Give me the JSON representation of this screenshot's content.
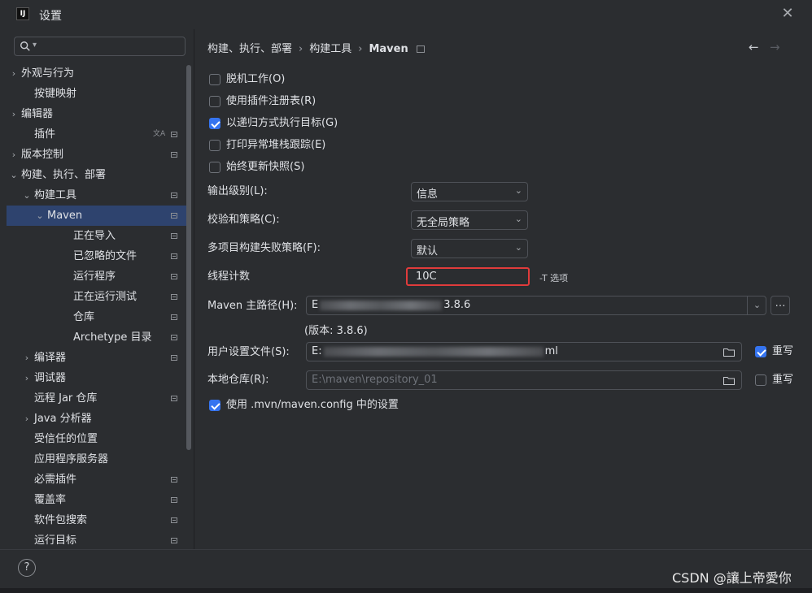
{
  "window": {
    "title": "设置",
    "app_icon_text": "IJ"
  },
  "sidebar": {
    "search_placeholder": "",
    "items": [
      {
        "label": "外观与行为",
        "chevron": "›",
        "has_badge": false
      },
      {
        "label": "按键映射",
        "chevron": "",
        "has_badge": false
      },
      {
        "label": "编辑器",
        "chevron": "›",
        "has_badge": false
      },
      {
        "label": "插件",
        "chevron": "",
        "has_badge": true
      },
      {
        "label": "版本控制",
        "chevron": "›",
        "has_badge": true
      },
      {
        "label": "构建、执行、部署",
        "chevron": "⌄",
        "has_badge": false
      },
      {
        "label": "构建工具",
        "chevron": "⌄",
        "has_badge": true
      },
      {
        "label": "Maven",
        "chevron": "⌄",
        "has_badge": true,
        "selected": true
      },
      {
        "label": "正在导入",
        "chevron": "",
        "has_badge": true
      },
      {
        "label": "已忽略的文件",
        "chevron": "",
        "has_badge": true
      },
      {
        "label": "运行程序",
        "chevron": "",
        "has_badge": true
      },
      {
        "label": "正在运行测试",
        "chevron": "",
        "has_badge": true
      },
      {
        "label": "仓库",
        "chevron": "",
        "has_badge": true
      },
      {
        "label": "Archetype 目录",
        "chevron": "",
        "has_badge": true
      },
      {
        "label": "编译器",
        "chevron": "›",
        "has_badge": true
      },
      {
        "label": "调试器",
        "chevron": "›",
        "has_badge": false
      },
      {
        "label": "远程 Jar 仓库",
        "chevron": "",
        "has_badge": true
      },
      {
        "label": "Java 分析器",
        "chevron": "›",
        "has_badge": false
      },
      {
        "label": "受信任的位置",
        "chevron": "",
        "has_badge": false
      },
      {
        "label": "应用程序服务器",
        "chevron": "",
        "has_badge": false
      },
      {
        "label": "必需插件",
        "chevron": "",
        "has_badge": true
      },
      {
        "label": "覆盖率",
        "chevron": "",
        "has_badge": true
      },
      {
        "label": "软件包搜索",
        "chevron": "",
        "has_badge": true
      },
      {
        "label": "运行目标",
        "chevron": "",
        "has_badge": true
      }
    ]
  },
  "breadcrumb": {
    "part1": "构建、执行、部署",
    "sep": "›",
    "part2": "构建工具",
    "part3": "Maven"
  },
  "nav": {
    "back": "←",
    "forward": "→"
  },
  "checkboxes": [
    {
      "label": "脱机工作(O)",
      "checked": false
    },
    {
      "label": "使用插件注册表(R)",
      "checked": false
    },
    {
      "label": "以递归方式执行目标(G)",
      "checked": true
    },
    {
      "label": "打印异常堆栈跟踪(E)",
      "checked": false
    },
    {
      "label": "始终更新快照(S)",
      "checked": false
    }
  ],
  "fields": {
    "output_level": {
      "label": "输出级别(L):",
      "value": "信息"
    },
    "checksum": {
      "label": "校验和策略(C):",
      "value": "无全局策略"
    },
    "multiproject": {
      "label": "多项目构建失败策略(F):",
      "value": "默认"
    },
    "threads": {
      "label": "线程计数",
      "value": "10C",
      "hint": "-T 选项"
    },
    "maven_home": {
      "label": "Maven 主路径(H):",
      "prefix": "E",
      "suffix": "3.8.6",
      "version": "(版本: 3.8.6)"
    },
    "user_settings": {
      "label": "用户设置文件(S):",
      "prefix": "E:",
      "suffix": "ml",
      "override_label": "重写",
      "override_checked": true
    },
    "local_repo": {
      "label": "本地仓库(R):",
      "value": "E:\\maven\\repository_01",
      "override_label": "重写",
      "override_checked": false
    },
    "mvn_config": {
      "label": "使用 .mvn/maven.config 中的设置",
      "checked": true
    }
  },
  "footer": {
    "help": "?",
    "watermark": "CSDN @讓上帝愛你"
  }
}
